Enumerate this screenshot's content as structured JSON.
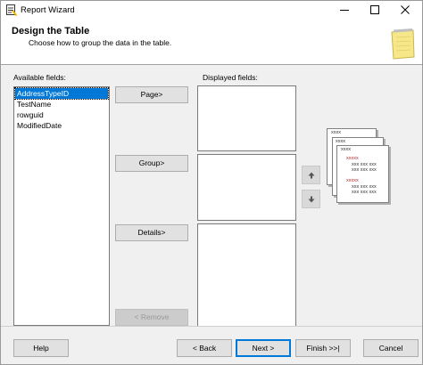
{
  "window": {
    "title": "Report Wizard"
  },
  "header": {
    "title": "Design the Table",
    "subtitle": "Choose how to group the data in the table."
  },
  "available": {
    "label": "Available fields:",
    "items": [
      {
        "label": "AddressTypeID",
        "selected": true
      },
      {
        "label": "TestName",
        "selected": false
      },
      {
        "label": "rowguid",
        "selected": false
      },
      {
        "label": "ModifiedDate",
        "selected": false
      }
    ]
  },
  "displayed": {
    "label": "Displayed fields:"
  },
  "move_buttons": {
    "page": "Page>",
    "group": "Group>",
    "details": "Details>",
    "remove": "< Remove"
  },
  "preview": {
    "placeholder": "xxxx",
    "group_value": "xxxxx",
    "detail_value": "xxx xxx xxx"
  },
  "footer": {
    "help": "Help",
    "back": "< Back",
    "next": "Next >",
    "finish": "Finish >>|",
    "cancel": "Cancel"
  },
  "colors": {
    "selection": "#0078d7",
    "placeholder_red": "#b03030"
  }
}
